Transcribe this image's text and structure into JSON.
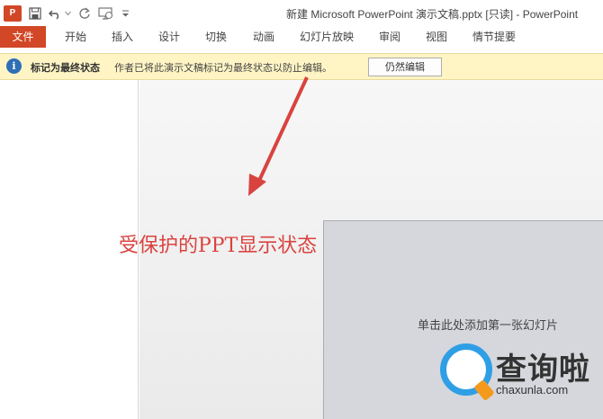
{
  "titlebar": {
    "app_logo_label": "P",
    "title": "新建 Microsoft PowerPoint 演示文稿.pptx [只读] - PowerPoint",
    "quick_access": [
      {
        "icon": "save-icon"
      },
      {
        "icon": "undo-icon"
      },
      {
        "icon": "redo-icon"
      },
      {
        "icon": "slideshow-icon"
      },
      {
        "icon": "customize-icon"
      }
    ]
  },
  "ribbon": {
    "tabs": [
      "文件",
      "开始",
      "插入",
      "设计",
      "切换",
      "动画",
      "幻灯片放映",
      "审阅",
      "视图",
      "情节提要"
    ],
    "file_color": "#d24726"
  },
  "message_bar": {
    "title": "标记为最终状态",
    "body": "作者已将此演示文稿标记为最终状态以防止编辑。",
    "button": "仍然编辑",
    "background": "#fff4c4"
  },
  "slide": {
    "placeholder": "单击此处添加第一张幻灯片"
  },
  "annotation": {
    "text": "受保护的PPT显示状态",
    "color": "#d9433f"
  },
  "watermark": {
    "brand": "查询啦",
    "url": "chaxunla.com"
  }
}
